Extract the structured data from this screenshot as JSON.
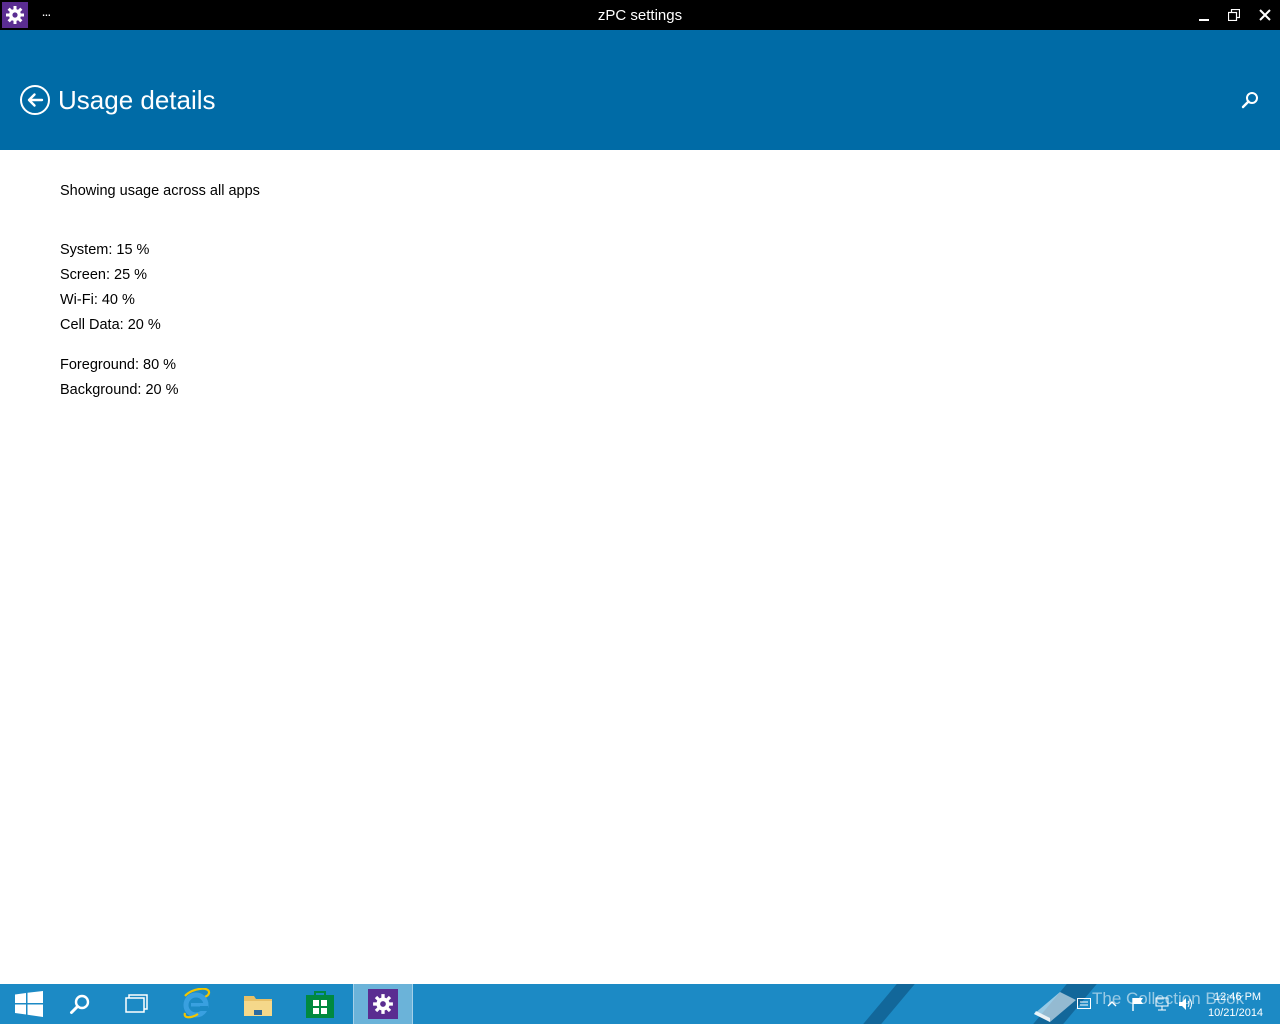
{
  "window": {
    "title": "zPC settings",
    "menu_label": "..."
  },
  "header": {
    "title": "Usage details",
    "background_color": "#006ba6"
  },
  "content": {
    "summary": "Showing usage across all apps",
    "breakdown": [
      {
        "label": "System: 15 %",
        "percent": 15
      },
      {
        "label": "Screen: 25 %",
        "percent": 25
      },
      {
        "label": "Wi-Fi: 40 %",
        "percent": 40
      },
      {
        "label": "Cell Data: 20 %",
        "percent": 20
      }
    ],
    "activity": [
      {
        "label": "Foreground: 80 %",
        "percent": 80
      },
      {
        "label": "Background: 20 %",
        "percent": 20
      }
    ]
  },
  "taskbar": {
    "pinned": [
      "start-icon",
      "search-icon",
      "task-view-icon",
      "internet-explorer-icon",
      "file-explorer-icon",
      "store-icon",
      "settings-icon"
    ],
    "active": "settings-icon",
    "watermark": "The Collection Book",
    "clock": {
      "time": "12:46 PM",
      "date": "10/21/2014"
    },
    "color": "#1c8ac5"
  },
  "icons": {
    "app": "gear-icon",
    "back": "back-arrow-icon",
    "search": "search-icon",
    "minimize": "minimize-icon",
    "restore": "restore-icon",
    "close": "close-icon"
  }
}
